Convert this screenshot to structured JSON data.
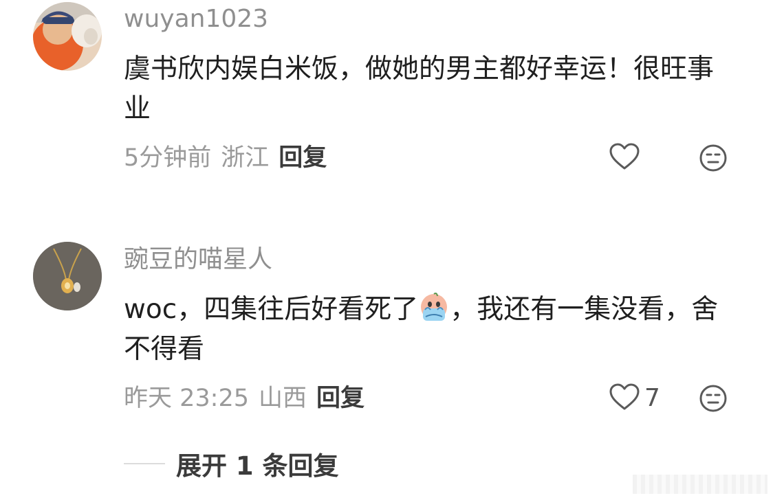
{
  "comments": [
    {
      "username": "wuyan1023",
      "text": "虞书欣内娱白米饭，做她的男主都好幸运！很旺事业",
      "time": "5分钟前",
      "location": "浙江",
      "reply_label": "回复",
      "like_count": "",
      "icons": {
        "like": "heart-icon",
        "dislike": "meh-face-icon"
      }
    },
    {
      "username": "豌豆的喵星人",
      "text_before_emoji": "woc，四集往后好看死了",
      "emoji": "crying-emoji",
      "text_after_emoji": "，我还有一集没看，舍不得看",
      "time": "昨天 23:25",
      "location": "山西",
      "reply_label": "回复",
      "like_count": "7",
      "icons": {
        "like": "heart-icon",
        "dislike": "meh-face-icon"
      }
    }
  ],
  "expand_replies": {
    "label": "展开 1 条回复"
  },
  "colors": {
    "username": "#8f8f8f",
    "meta": "#9a9a9a",
    "text": "#1f1f1f",
    "action": "#3b3b3b"
  }
}
